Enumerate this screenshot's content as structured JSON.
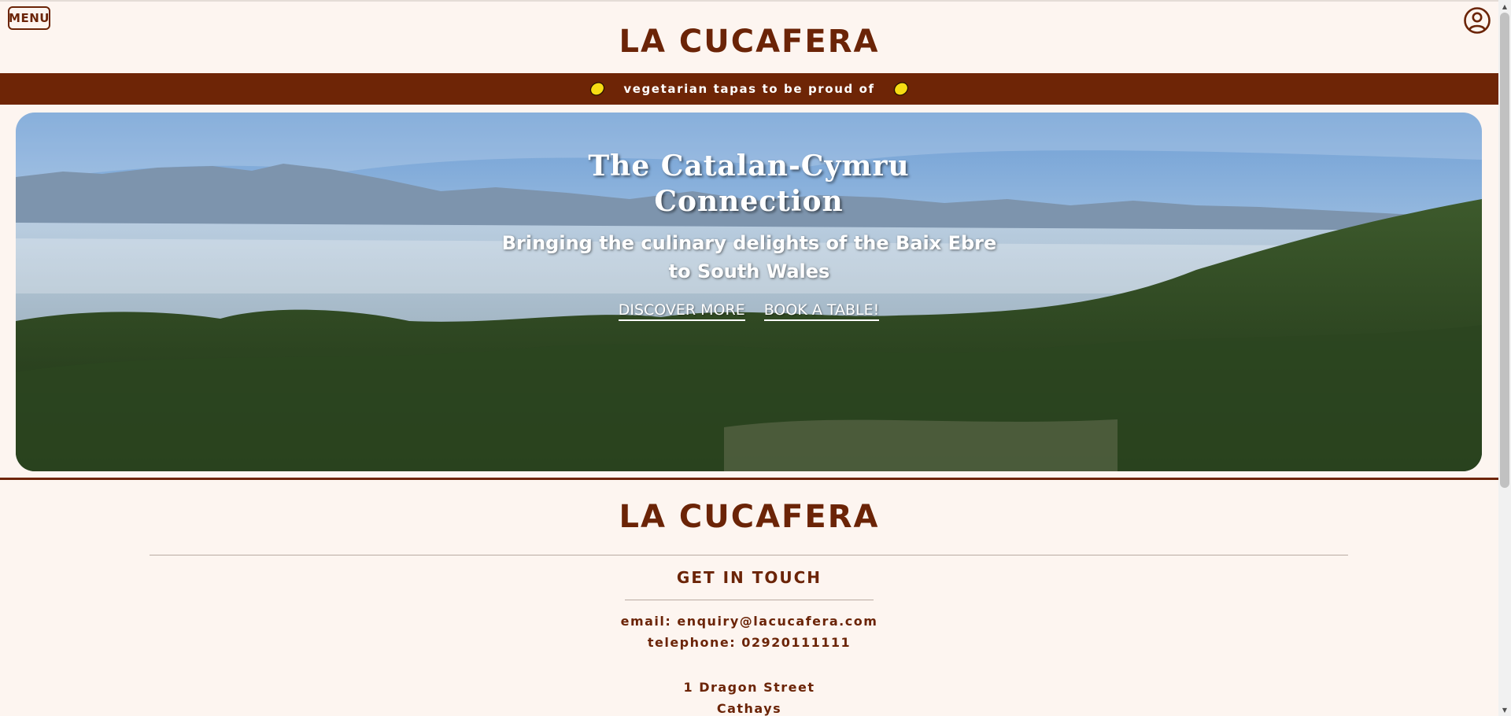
{
  "header": {
    "menu_label": "MENU",
    "logo": "LA CUCAFERA",
    "account_icon": "user-circle-icon"
  },
  "banner": {
    "text": "vegetarian tapas to be proud of",
    "icon": "lemon-icon"
  },
  "hero": {
    "title_line1": "The Catalan-Cymru",
    "title_line2": "Connection",
    "subtitle": "Bringing the culinary delights of the Baix Ebre to South Wales",
    "discover_label": "DISCOVER MORE",
    "book_label": "BOOK A TABLE!"
  },
  "footer": {
    "logo": "LA CUCAFERA",
    "section_title": "GET IN TOUCH",
    "email": "email: enquiry@lacucafera.com",
    "telephone": "telephone: 02920111111",
    "address_line1": "1 Dragon Street",
    "address_line2": "Cathays"
  },
  "colors": {
    "brand_brown": "#6e2506",
    "background": "#fdf5f0",
    "lemon": "#f6dd13"
  }
}
